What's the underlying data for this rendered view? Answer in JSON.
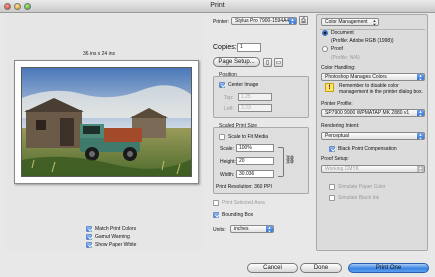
{
  "window": {
    "title": "Print"
  },
  "preview": {
    "dimensions": "36 ins x 24 ins",
    "options": [
      {
        "label": "Match Print Colors",
        "checked": true
      },
      {
        "label": "Gamut Warning",
        "checked": true
      },
      {
        "label": "Show Paper White",
        "checked": true
      }
    ]
  },
  "printer": {
    "label": "Printer:",
    "value": "Stylus Pro 7900-1594A4"
  },
  "copies": {
    "label": "Copies:",
    "value": "1"
  },
  "page_setup": {
    "label": "Page Setup..."
  },
  "position": {
    "title": "Position",
    "center_image": "Center Image",
    "top_label": "Top:",
    "top_value": "1.25",
    "left_label": "Left:",
    "left_value": "3.23"
  },
  "scaled_size": {
    "title": "Scaled Print Size",
    "scale_to_fit": "Scale to Fit Media",
    "scale_label": "Scale:",
    "scale_value": "100%",
    "height_label": "Height:",
    "height_value": "20",
    "width_label": "Width:",
    "width_value": "30.036",
    "resolution": "Print Resolution: 360 PPI"
  },
  "print_selected_area": "Print Selected Area",
  "bounding_box": "Bounding Box",
  "units": {
    "label": "Units:",
    "value": "inches"
  },
  "color_mgmt": {
    "section": "Color Management",
    "document_label": "Document",
    "document_profile": "(Profile: Adobe RGB (1998))",
    "proof_label": "Proof",
    "proof_profile": "(Profile: N/A)",
    "color_handling_label": "Color Handling:",
    "color_handling_value": "Photoshop Manages Colors",
    "reminder": "Remember to disable color management in the printer dialog box.",
    "printer_profile_label": "Printer Profile:",
    "printer_profile_value": "SP7900 9900 WPMATAP MK 2880 v1",
    "rendering_intent_label": "Rendering Intent:",
    "rendering_intent_value": "Perceptual",
    "bpc_label": "Black Point Compensation",
    "proof_setup_label": "Proof Setup:",
    "proof_setup_value": "Working CMYK",
    "simulate_paper": "Simulate Paper Color",
    "simulate_ink": "Simulate Black Ink"
  },
  "buttons": {
    "cancel": "Cancel",
    "done": "Done",
    "print_one": "Print One"
  }
}
